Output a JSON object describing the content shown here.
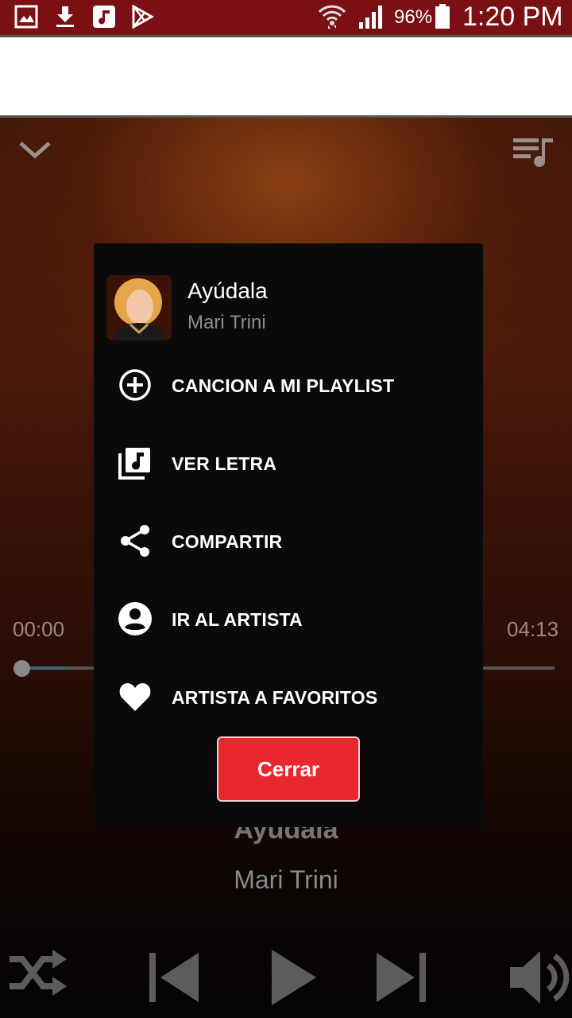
{
  "status_bar": {
    "icons": [
      "image-icon",
      "download-icon",
      "music-note-icon",
      "play-store-icon",
      "wifi-icon",
      "signal-icon",
      "battery-icon"
    ],
    "battery_percent": "96%",
    "time": "1:20 PM"
  },
  "player": {
    "current_time": "00:00",
    "duration": "04:13",
    "progress": 0.08,
    "song_title": "Ayúdala",
    "artist": "Mari Trini",
    "icons": [
      "chevron-down-icon",
      "queue-music-icon",
      "shuffle-icon",
      "skip-previous-icon",
      "play-icon",
      "skip-next-icon",
      "volume-icon"
    ]
  },
  "dialog": {
    "song_title": "Ayúdala",
    "artist": "Mari Trini",
    "menu": [
      {
        "label": "CANCION A MI PLAYLIST",
        "icon": "add-circle-icon"
      },
      {
        "label": "VER LETRA",
        "icon": "library-music-icon"
      },
      {
        "label": "COMPARTIR",
        "icon": "share-icon"
      },
      {
        "label": "IR AL ARTISTA",
        "icon": "account-circle-icon"
      },
      {
        "label": "ARTISTA A FAVORITOS",
        "icon": "heart-icon"
      }
    ],
    "close_label": "Cerrar",
    "close_color": "#e8282c"
  }
}
